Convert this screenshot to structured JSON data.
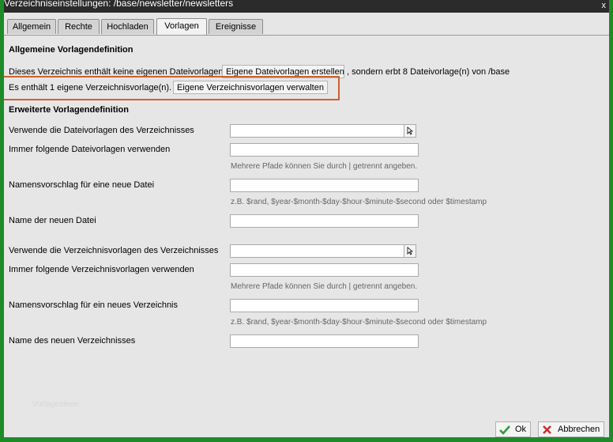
{
  "window": {
    "title": "Verzeichniseinstellungen: /base/newsletter/newsletters",
    "close": "x"
  },
  "tabs": [
    "Allgemein",
    "Rechte",
    "Hochladen",
    "Vorlagen",
    "Ereignisse"
  ],
  "active_tab": "Vorlagen",
  "general": {
    "title": "Allgemeine Vorlagendefinition",
    "no_templates_text": "Dieses Verzeichnis enthält keine eigenen Dateivorlagen",
    "create_button": "Eigene Dateivorlagen erstellen",
    "inherits_text": ", sondern erbt 8 Dateivorlage(n) von /base",
    "dir_templates_text": "Es enthält 1 eigene Verzeichnisvorlage(n).",
    "manage_button": "Eigene Verzeichnisvorlagen verwalten"
  },
  "advanced": {
    "title": "Erweiterte Vorlagendefinition",
    "fields": [
      {
        "label": "Verwende die Dateivorlagen des Verzeichnisses",
        "value": "",
        "type": "combo"
      },
      {
        "label": "Immer folgende Dateivorlagen verwenden",
        "value": "",
        "type": "text",
        "hint": "Mehrere Pfade können Sie durch | getrennt angeben."
      },
      {
        "label": "Namensvorschlag für eine neue Datei",
        "value": "",
        "type": "text",
        "hint": "z.B. $rand, $year-$month-$day-$hour-$minute-$second oder $timestamp"
      },
      {
        "label": "Name der neuen Datei",
        "value": "",
        "type": "text"
      },
      {
        "label": "Verwende die Verzeichnisvorlagen des Verzeichnisses",
        "value": "",
        "type": "combo"
      },
      {
        "label": "Immer folgende Verzeichnisvorlagen verwenden",
        "value": "",
        "type": "text",
        "hint": "Mehrere Pfade können Sie durch | getrennt angeben."
      },
      {
        "label": "Namensvorschlag für ein neues Verzeichnis",
        "value": "",
        "type": "text",
        "hint": "z.B. $rand, $year-$month-$day-$hour-$minute-$second oder $timestamp"
      },
      {
        "label": "Name des neuen Verzeichnisses",
        "value": "",
        "type": "text"
      }
    ]
  },
  "footer": {
    "watermark": "VorlageIdeen",
    "ok": "Ok",
    "cancel": "Abbrechen"
  },
  "colors": {
    "frame": "#1f8a2a",
    "highlight": "#c9632d",
    "ok_check": "#2e9e3a",
    "cancel_x": "#cc2a2a"
  }
}
